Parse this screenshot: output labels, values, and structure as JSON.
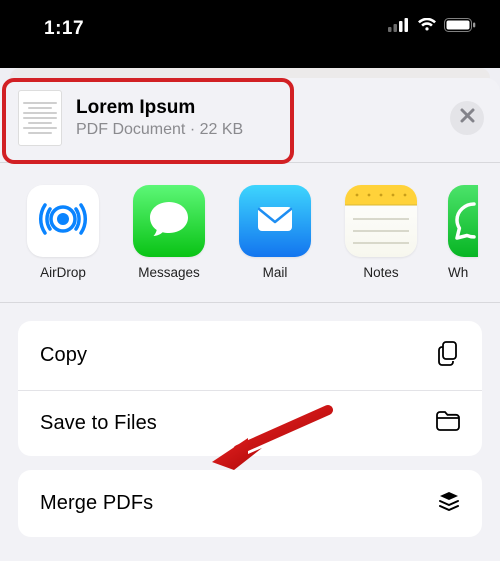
{
  "status": {
    "time": "1:17"
  },
  "document": {
    "title": "Lorem Ipsum",
    "subtitle": "PDF Document · 22 KB"
  },
  "apps": {
    "items": [
      {
        "label": "AirDrop"
      },
      {
        "label": "Messages"
      },
      {
        "label": "Mail"
      },
      {
        "label": "Notes"
      },
      {
        "label": "Wh"
      }
    ]
  },
  "actions": {
    "group1": [
      {
        "label": "Copy"
      },
      {
        "label": "Save to Files"
      }
    ],
    "group2": [
      {
        "label": "Merge PDFs"
      }
    ]
  }
}
